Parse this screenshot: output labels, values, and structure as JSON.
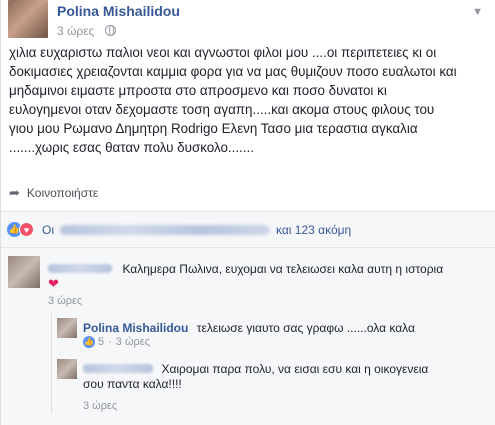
{
  "post": {
    "author": "Polina Mishailidou",
    "time": "3 ώρες",
    "text_lines": [
      "χιλια ευχαριστω παλιοι νεοι και αγνωστοι φιλοι μου ....οι περιπετειες κι οι",
      "δοκιμασιες χρειαζονται καμμια φορα για να μας θυμιζουν ποσο ευαλωτοι και",
      "μηδαμινοι ειμαστε μπροστα στο απροσμενο και ποσο δυνατοι κι",
      "ευλογημενοι οταν δεχομαστε τοση αγαπη.....και ακομα στους φιλους του",
      "γιου μου Ρωμανο Δημητρη Rodrigo Ελενη Τασο μια τεραστια αγκαλια",
      ".......χωρις εσας θαταν πολυ δυσκολο......."
    ],
    "share_label": "Κοινοποιήστε"
  },
  "reactions": {
    "prefix": "Οι",
    "suffix": "και 123 ακόμη"
  },
  "comments": [
    {
      "text": "Καλημερα Πωλινα, ευχομαι να τελειωσει καλα αυτη η ιστορια",
      "time": "3 ώρες"
    },
    {
      "author": "Polina Mishailidou",
      "text": "τελειωσε γιαυτο σας γραφω ......ολα καλα",
      "likes": "5",
      "time": "3 ώρες"
    },
    {
      "text_line1": "Χαιρομαι παρα πολυ, να εισαι εσυ και η οικογενεια",
      "text_line2": "σου παντα καλα!!!!",
      "time": "3 ώρες"
    }
  ],
  "icons": {
    "like_color": "#5890ff",
    "love_color": "#f25268",
    "link_color": "#365899"
  }
}
